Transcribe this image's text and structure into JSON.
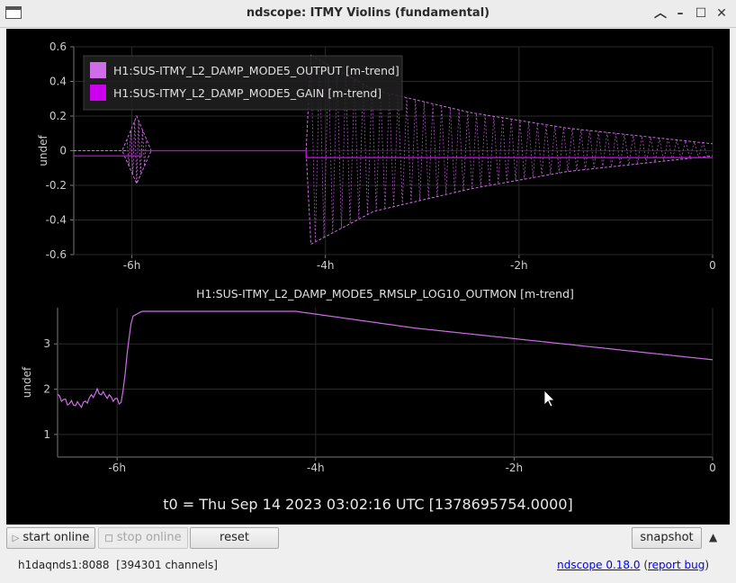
{
  "window": {
    "title": "ndscope: ITMY Violins (fundamental)"
  },
  "colors": {
    "output": "#cf6ce8",
    "gain": "#cc00ee",
    "rmslp": "#cf6ce8"
  },
  "chart_data": [
    {
      "type": "line",
      "title": "",
      "ylabel": "undef",
      "ylim": [
        -0.6,
        0.6
      ],
      "xlim": [
        "-6.6h",
        "0"
      ],
      "x_ticks": [
        "-6h",
        "-4h",
        "-2h",
        "0"
      ],
      "y_ticks": [
        "0.6",
        "0.4",
        "0.2",
        "0",
        "-0.2",
        "-0.4",
        "-0.6"
      ],
      "legend_position": "top-left",
      "series": [
        {
          "name": "H1:SUS-ITMY_L2_DAMP_MODE5_OUTPUT [m-trend]",
          "style": "dashed envelope",
          "x_hours": [
            -6.6,
            -6.1,
            -5.95,
            -5.8,
            -4.2,
            -4.15,
            -3.5,
            -2.5,
            -1.5,
            -0.5,
            0
          ],
          "max": [
            0,
            0,
            0.2,
            0,
            0,
            0.55,
            0.35,
            0.22,
            0.13,
            0.07,
            0.04
          ],
          "min": [
            0,
            0,
            -0.19,
            0,
            0,
            -0.54,
            -0.35,
            -0.22,
            -0.12,
            -0.06,
            -0.03
          ]
        },
        {
          "name": "H1:SUS-ITMY_L2_DAMP_MODE5_GAIN [m-trend]",
          "style": "solid",
          "x_hours": [
            -6.6,
            -5.9,
            -5.9,
            -4.2,
            -4.2,
            0
          ],
          "values": [
            -0.03,
            -0.03,
            0,
            0,
            -0.04,
            -0.04
          ]
        }
      ]
    },
    {
      "type": "line",
      "title": "H1:SUS-ITMY_L2_DAMP_MODE5_RMSLP_LOG10_OUTMON [m-trend]",
      "ylabel": "undef",
      "ylim": [
        0.5,
        3.8
      ],
      "xlim": [
        "-6.6h",
        "0"
      ],
      "x_ticks": [
        "-6h",
        "-4h",
        "-2h",
        "0"
      ],
      "y_ticks": [
        "3",
        "2",
        "1"
      ],
      "series": [
        {
          "name": "H1:SUS-ITMY_L2_DAMP_MODE5_RMSLP_LOG10_OUTMON [m-trend]",
          "x_hours": [
            -6.6,
            -6.5,
            -6.35,
            -6.2,
            -6.05,
            -5.95,
            -5.9,
            -5.85,
            -5.75,
            -4.2,
            -3,
            -1.5,
            0
          ],
          "values": [
            1.85,
            1.7,
            1.65,
            1.95,
            1.8,
            1.7,
            2.8,
            3.6,
            3.72,
            3.72,
            3.35,
            3.0,
            2.65
          ]
        }
      ]
    }
  ],
  "t0_label": "t0 = Thu Sep 14 2023 03:02:16 UTC [1378695754.0000]",
  "buttons": {
    "start": "start online",
    "stop": "stop online",
    "reset": "reset",
    "snapshot": "snapshot"
  },
  "status": {
    "server": "h1daqnds1:8088  [394301 channels]",
    "version_link": "ndscope 0.18.0",
    "report_link": "report bug"
  }
}
